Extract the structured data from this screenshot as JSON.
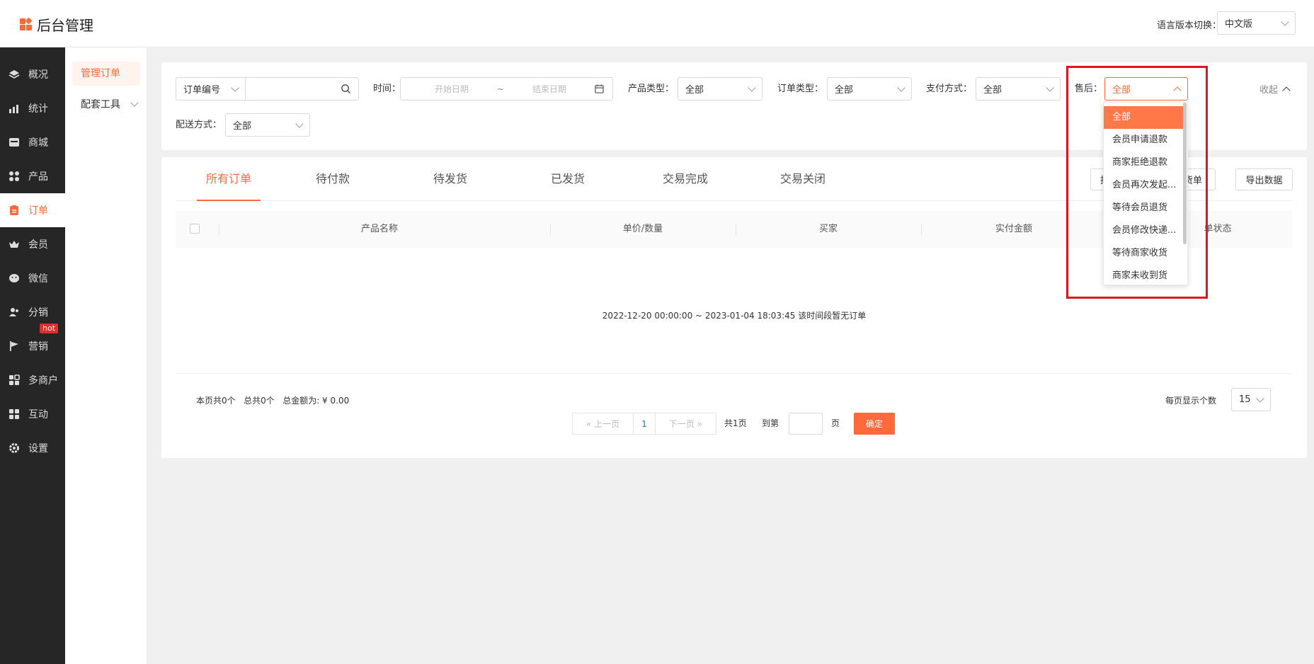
{
  "app": {
    "title": "后台管理"
  },
  "header": {
    "lang_label": "语言版本切换：",
    "lang_value": "中文版"
  },
  "sidebar": {
    "items": [
      {
        "label": "概况",
        "icon": "layers-icon"
      },
      {
        "label": "统计",
        "icon": "chart-icon"
      },
      {
        "label": "商城",
        "icon": "shop-icon"
      },
      {
        "label": "产品",
        "icon": "grid-icon"
      },
      {
        "label": "订单",
        "icon": "order-icon",
        "active": true
      },
      {
        "label": "会员",
        "icon": "crown-icon"
      },
      {
        "label": "微信",
        "icon": "wechat-icon"
      },
      {
        "label": "分销",
        "icon": "users-icon"
      },
      {
        "label": "营销",
        "icon": "flag-icon",
        "badge": "hot"
      },
      {
        "label": "多商户",
        "icon": "store-icon"
      },
      {
        "label": "互动",
        "icon": "apps-icon"
      },
      {
        "label": "设置",
        "icon": "gear-icon"
      }
    ]
  },
  "subnav": {
    "items": [
      {
        "label": "管理订单",
        "active": true
      },
      {
        "label": "配套工具"
      }
    ]
  },
  "filters": {
    "order_field": "订单编号",
    "search_value": "",
    "time_label": "时间：",
    "start_placeholder": "开始日期",
    "range_sep": "~",
    "end_placeholder": "结束日期",
    "product_type_label": "产品类型：",
    "product_type_value": "全部",
    "order_type_label": "订单类型：",
    "order_type_value": "全部",
    "payment_label": "支付方式：",
    "payment_value": "全部",
    "aftersale_label": "售后：",
    "aftersale_value": "全部",
    "collapse_label": "收起",
    "delivery_label": "配送方式：",
    "delivery_value": "全部"
  },
  "aftersale_options": [
    "全部",
    "会员申请退款",
    "商家拒绝退款",
    "会员再次发起...",
    "等待会员退货",
    "会员修改快递...",
    "等待商家收货",
    "商家未收到货"
  ],
  "tabs": [
    "所有订单",
    "待付款",
    "待发货",
    "已发货",
    "交易完成",
    "交易关闭"
  ],
  "actions": {
    "btn1": "批",
    "btn2": "出货单",
    "export": "导出数据"
  },
  "table": {
    "columns": [
      "产品名称",
      "单价/数量",
      "买家",
      "实付金额",
      "单状态"
    ]
  },
  "empty_message": "2022-12-20 00:00:00 ~ 2023-01-04 18:03:45 该时间段暂无订单",
  "summary": {
    "page_count": "本页共0个",
    "total_count": "总共0个",
    "total_amount": "总金额为: ¥ 0.00"
  },
  "pager": {
    "prev": "上一页",
    "current": "1",
    "next": "下一页",
    "total_pages": "共1页",
    "goto_label": "到第",
    "page_unit": "页",
    "confirm": "确定",
    "per_page_label": "每页显示个数",
    "per_page_value": "15"
  },
  "colors": {
    "accent": "#ff6a3d",
    "sidebar_bg": "#262626",
    "highlight": "#e0141e"
  }
}
